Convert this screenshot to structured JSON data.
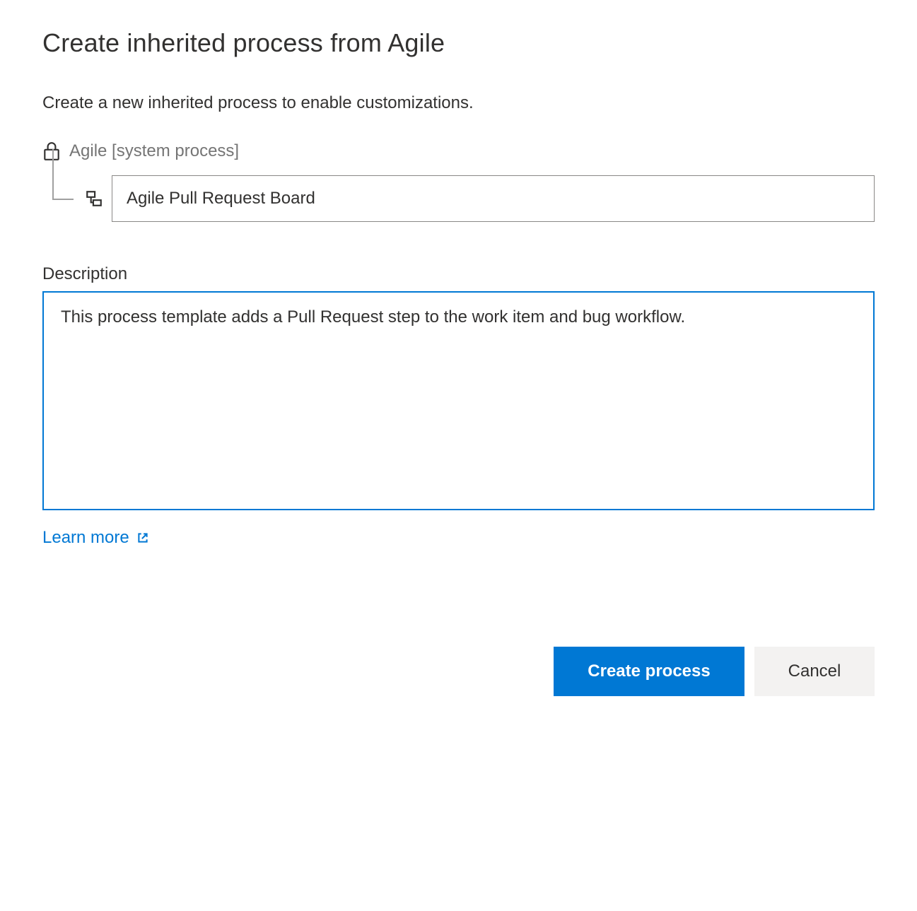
{
  "dialog": {
    "title": "Create inherited process from Agile",
    "subtitle": "Create a new inherited process to enable customizations.",
    "parent_process_label": "Agile [system process]",
    "process_name_value": "Agile Pull Request Board",
    "description_label": "Description",
    "description_value": "This process template adds a Pull Request step to the work item and bug workflow.",
    "learn_more_label": "Learn more",
    "buttons": {
      "primary": "Create process",
      "secondary": "Cancel"
    }
  },
  "colors": {
    "accent": "#0078d4",
    "text": "#323130",
    "muted": "#757575",
    "border": "#8a8886"
  }
}
